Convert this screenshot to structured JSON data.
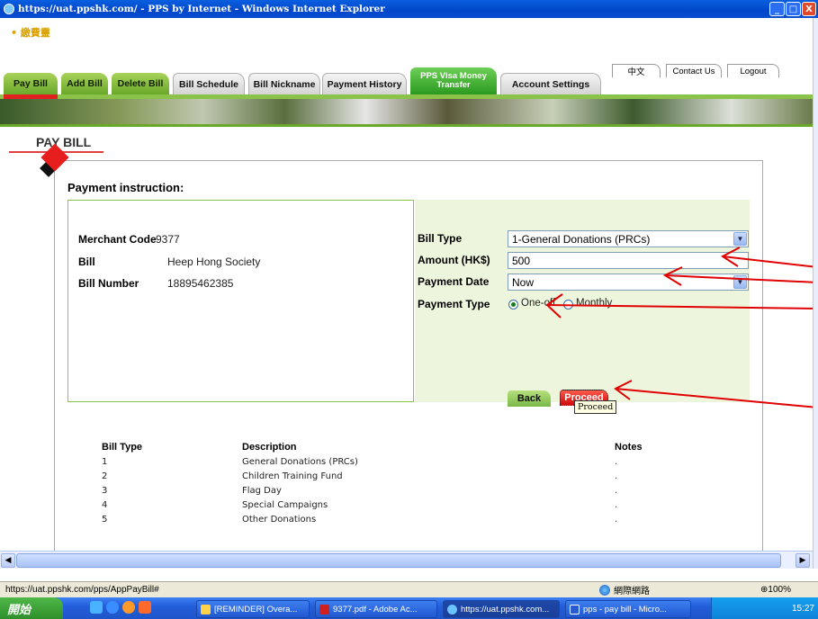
{
  "window": {
    "title": "https://uat.ppshk.com/ - PPS by Internet - Windows Internet Explorer",
    "min": "_",
    "max": "□",
    "close": "X"
  },
  "logo_text": "• 繳費靈",
  "top_links": [
    "中文",
    "Contact Us",
    "Logout"
  ],
  "tabs": [
    "Pay Bill",
    "Add Bill",
    "Delete Bill",
    "Bill Schedule",
    "Bill Nickname",
    "Payment History",
    "PPS Visa Money Transfer",
    "Account Settings"
  ],
  "page_title": "PAY BILL",
  "instruction_title": "Payment instruction:",
  "left": {
    "merchant_label": "Merchant Code",
    "merchant_value": "9377",
    "bill_label": "Bill",
    "bill_value": "Heep Hong Society",
    "billno_label": "Bill Number",
    "billno_value": "18895462385"
  },
  "right": {
    "bill_type_label": "Bill Type",
    "bill_type_value": "1-General Donations (PRCs)",
    "amount_label": "Amount (HK$)",
    "amount_value": "500",
    "date_label": "Payment Date",
    "date_value": "Now",
    "ptype_label": "Payment Type",
    "ptype_oneoff": "One-off",
    "ptype_monthly": "Monthly"
  },
  "buttons": {
    "back": "Back",
    "proceed": "Proceed",
    "tooltip": "Proceed"
  },
  "bill_table": {
    "headers": [
      "Bill Type",
      "Description",
      "Notes"
    ],
    "rows": [
      [
        "1",
        "General Donations (PRCs)",
        "."
      ],
      [
        "2",
        "Children Training Fund",
        "."
      ],
      [
        "3",
        "Flag Day",
        "."
      ],
      [
        "4",
        "Special Campaigns",
        "."
      ],
      [
        "5",
        "Other Donations",
        "."
      ]
    ]
  },
  "status": {
    "url": "https://uat.ppshk.com/pps/AppPayBill#",
    "zone": "網際網路",
    "zoom": "⊕100%"
  },
  "taskbar": {
    "start": "開始",
    "tasks": [
      "[REMINDER] Overa...",
      "9377.pdf - Adobe Ac...",
      "https://uat.ppshk.com...",
      "pps - pay bill - Micro..."
    ],
    "clock": "15:27"
  },
  "colors": {
    "accent_green": "#8bc34a",
    "proceed_red": "#e02020",
    "annotation_red": "#e00000"
  }
}
